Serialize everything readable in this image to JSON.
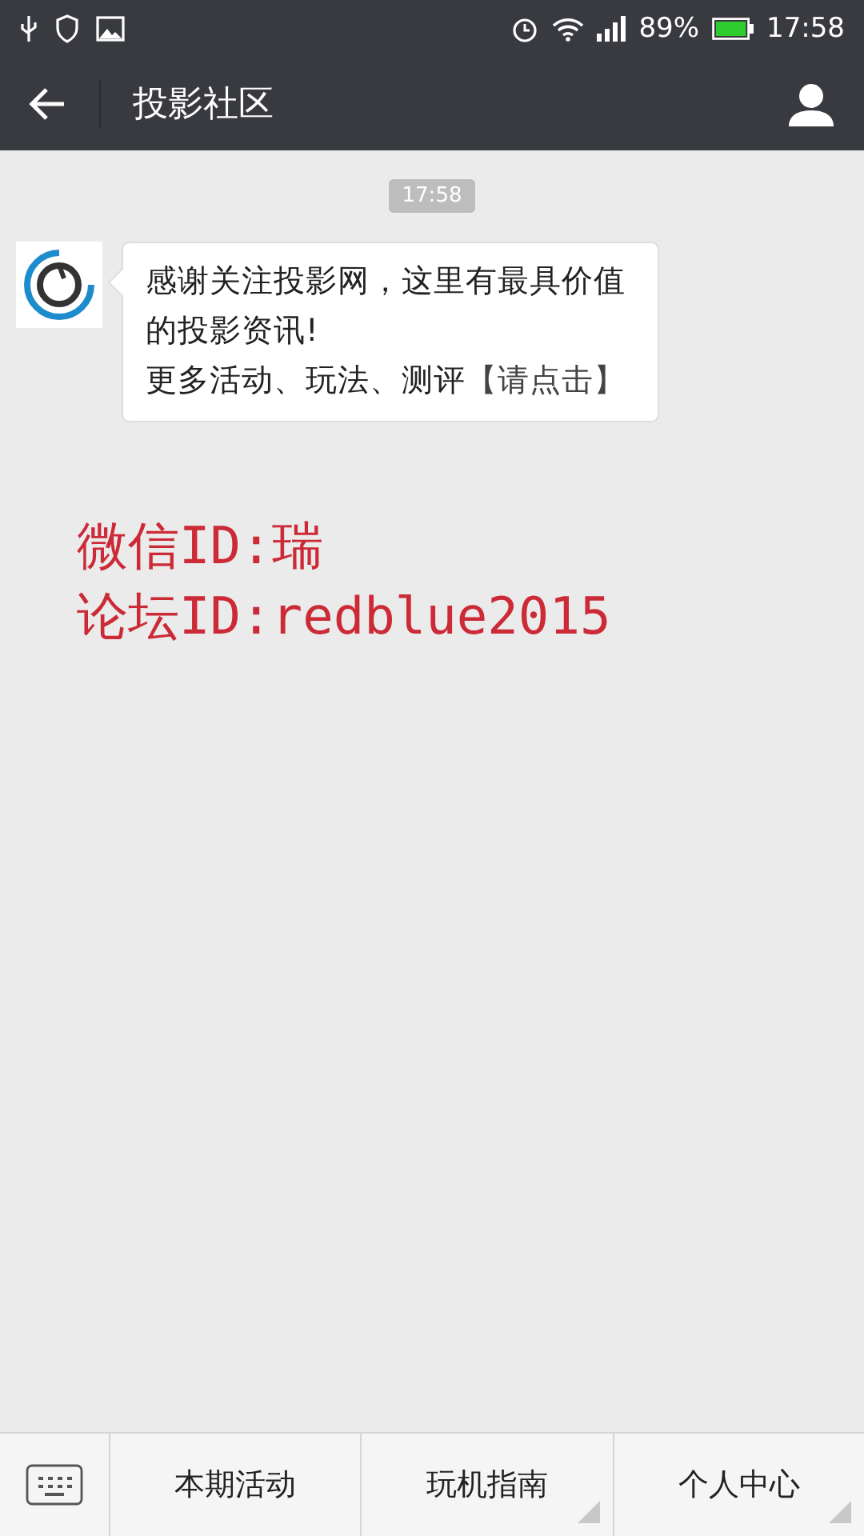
{
  "status_bar": {
    "battery": "89%",
    "time": "17:58"
  },
  "header": {
    "title": "投影社区"
  },
  "chat": {
    "timestamp": "17:58",
    "messages": [
      {
        "text": "感谢关注投影网，这里有最具价值的投影资讯!\n更多活动、玩法、测评",
        "link": "【请点击】"
      }
    ]
  },
  "annotation": [
    "微信ID:瑞",
    "论坛ID:redblue2015"
  ],
  "menu": [
    {
      "label": "本期活动",
      "has_submenu": false
    },
    {
      "label": "玩机指南",
      "has_submenu": true
    },
    {
      "label": "个人中心",
      "has_submenu": true
    }
  ]
}
